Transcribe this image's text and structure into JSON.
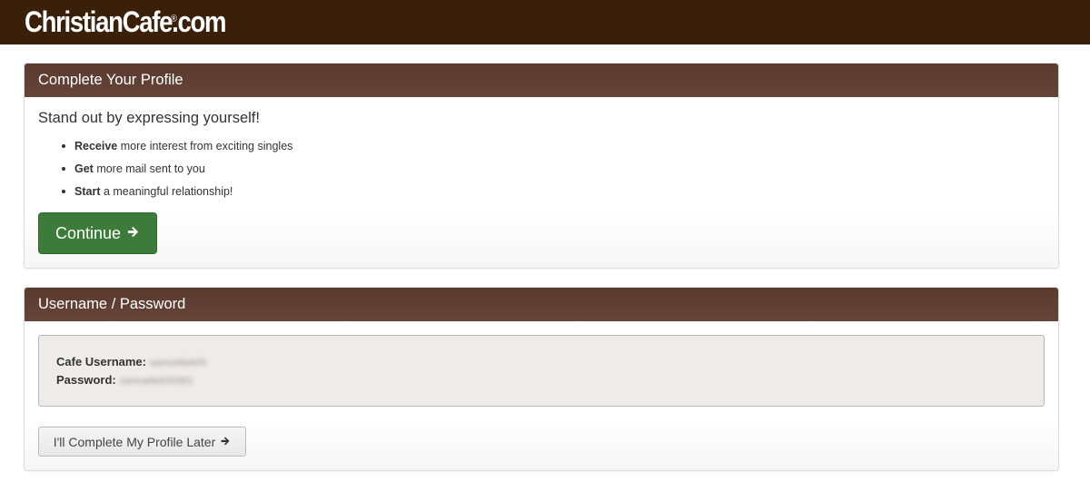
{
  "header": {
    "logo_text": "ChristianCafe.com",
    "logo_mark": "®"
  },
  "profile_panel": {
    "title": "Complete Your Profile",
    "tagline": "Stand out by expressing yourself!",
    "bullets": [
      {
        "bold": "Receive",
        "text": " more interest from exciting singles"
      },
      {
        "bold": "Get",
        "text": " more mail sent to you"
      },
      {
        "bold": "Start",
        "text": " a meaningful relationship!"
      }
    ],
    "continue_label": "Continue",
    "continue_icon": "arrow-right-icon"
  },
  "credentials_panel": {
    "title": "Username / Password",
    "username_label": "Cafe Username:",
    "username_value": "samuelle845",
    "password_label": "Password:",
    "password_value": "samuelle845981",
    "later_label": "I'll Complete My Profile Later",
    "later_icon": "arrow-right-icon"
  },
  "colors": {
    "topbar": "#3b2009",
    "panel_header": "#5f4034",
    "continue_button": "#3c7b39",
    "credentials_bg": "#efebe9"
  }
}
